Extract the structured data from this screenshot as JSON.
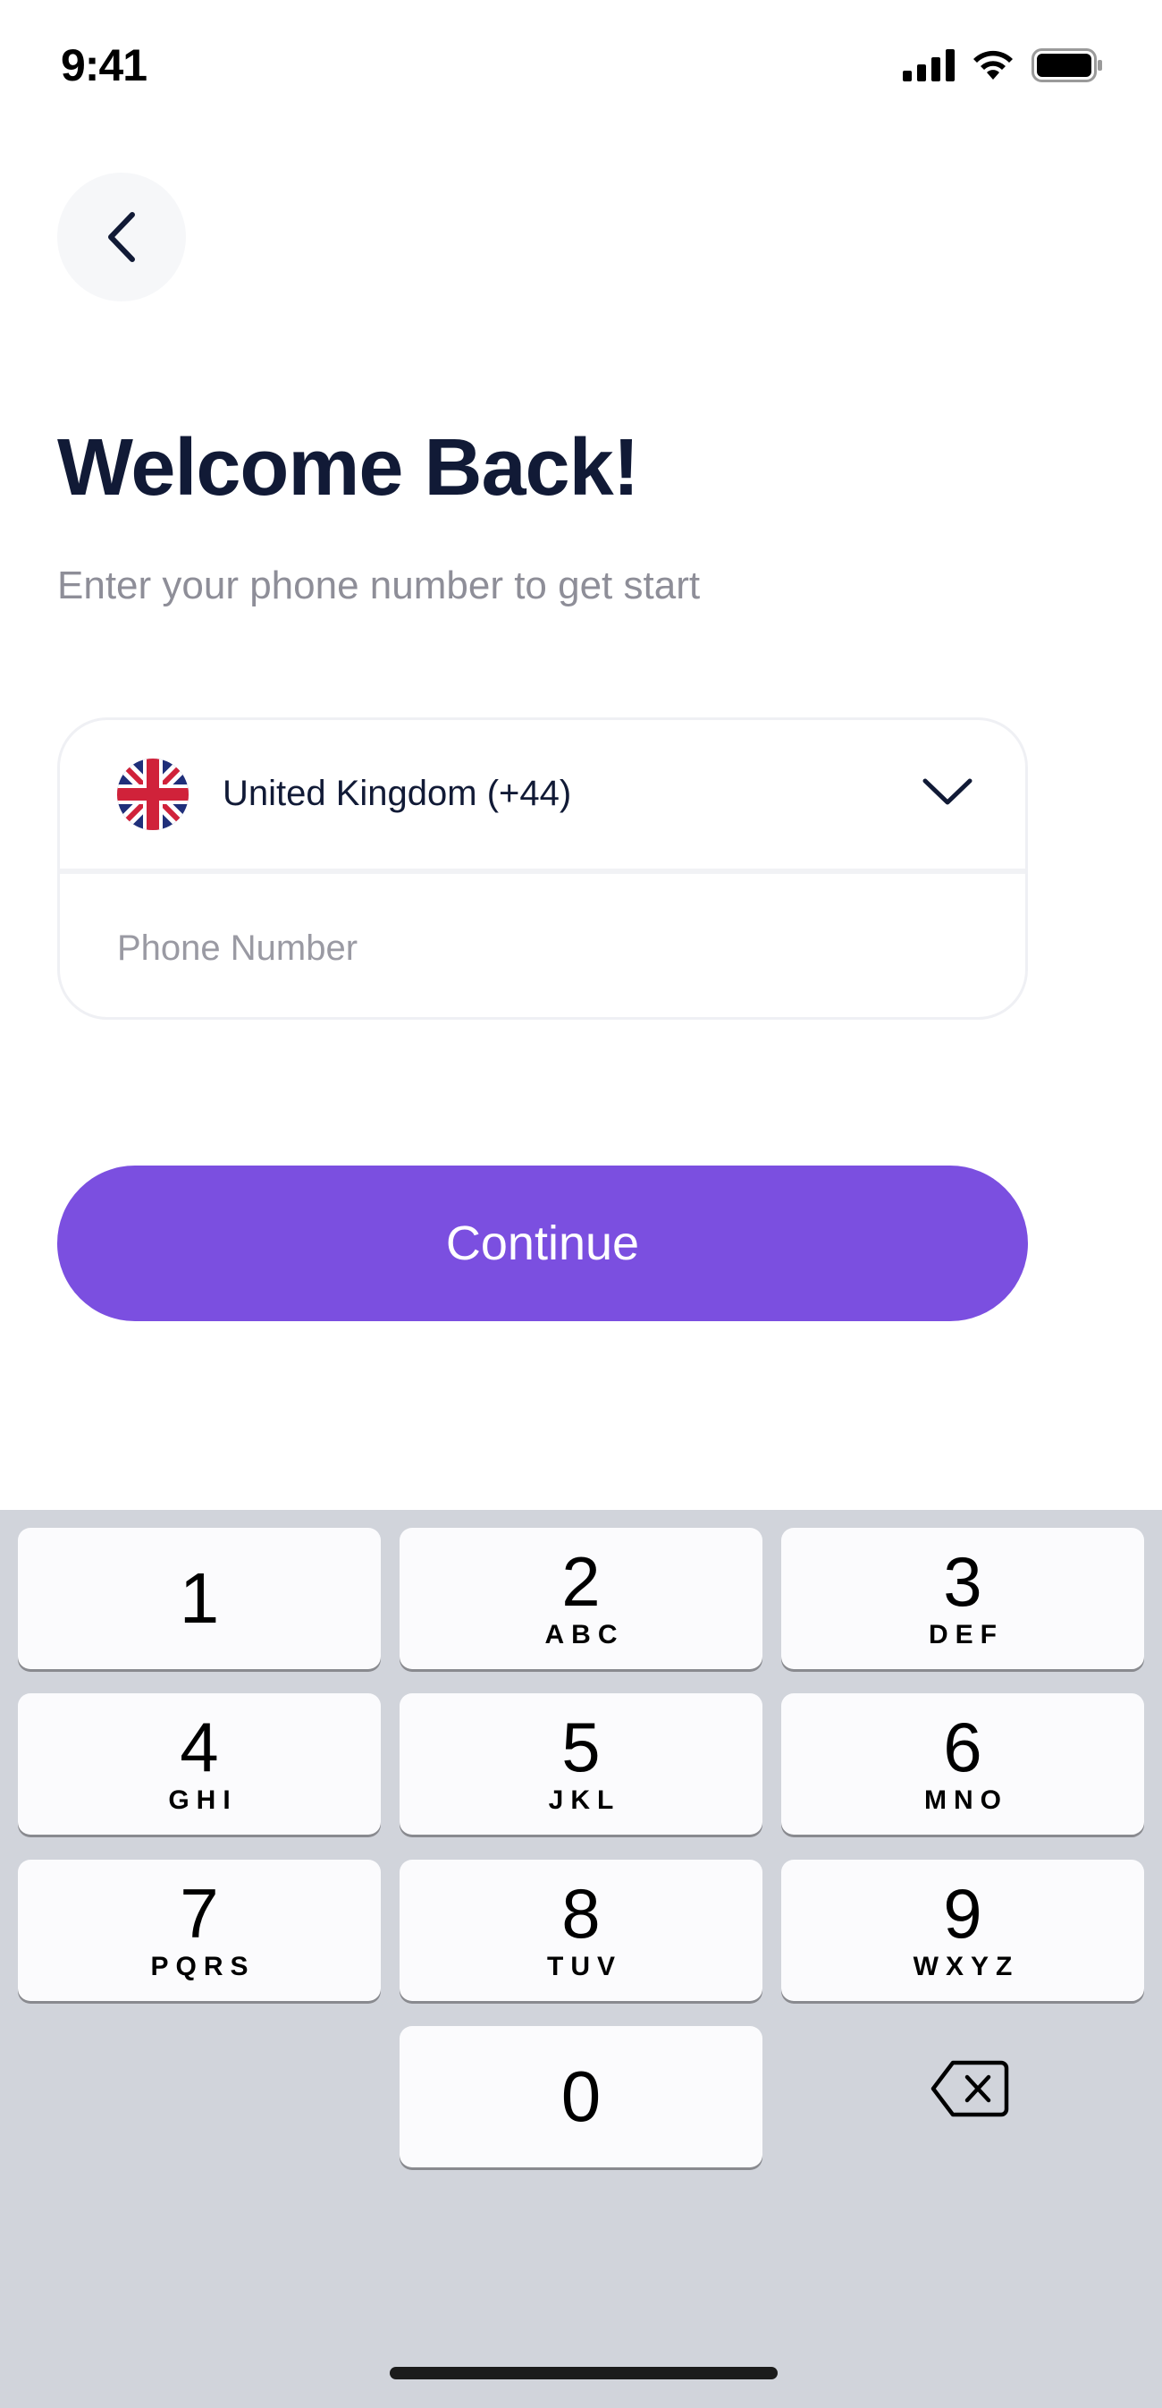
{
  "status_bar": {
    "time": "9:41",
    "icons": [
      "cellular-signal-icon",
      "wifi-icon",
      "battery-icon"
    ]
  },
  "header": {
    "back_icon": "chevron-left-icon"
  },
  "main": {
    "title": "Welcome Back!",
    "subtitle": "Enter your phone number to get start",
    "country_selector": {
      "flag": "uk-flag-icon",
      "label": "United Kingdom (+44)",
      "dropdown_icon": "chevron-down-icon"
    },
    "phone_input": {
      "value": "",
      "placeholder": "Phone Number"
    },
    "continue_label": "Continue",
    "accent_color": "#7b4fe0"
  },
  "keyboard": {
    "keys": [
      {
        "num": "1",
        "letters": ""
      },
      {
        "num": "2",
        "letters": "ABC"
      },
      {
        "num": "3",
        "letters": "DEF"
      },
      {
        "num": "4",
        "letters": "GHI"
      },
      {
        "num": "5",
        "letters": "JKL"
      },
      {
        "num": "6",
        "letters": "MNO"
      },
      {
        "num": "7",
        "letters": "PQRS"
      },
      {
        "num": "8",
        "letters": "TUV"
      },
      {
        "num": "9",
        "letters": "WXYZ"
      },
      {
        "num": "0",
        "letters": ""
      }
    ],
    "backspace_icon": "backspace-icon"
  }
}
